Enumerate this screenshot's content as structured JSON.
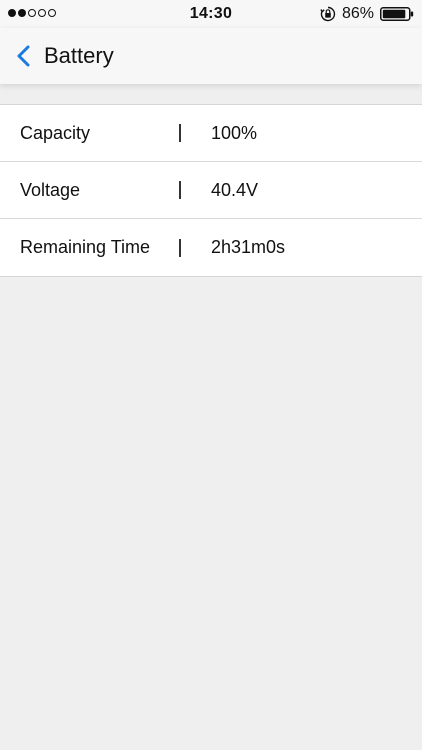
{
  "status_bar": {
    "signal_dots": [
      true,
      true,
      false,
      false,
      false
    ],
    "time": "14:30",
    "battery_percent": "86%",
    "icons": [
      "orientation-lock-icon",
      "battery-icon"
    ]
  },
  "nav": {
    "back_icon": "chevron-left-icon",
    "title": "Battery",
    "accent_color": "#1a7ae0"
  },
  "rows": [
    {
      "label": "Capacity",
      "value": "100%"
    },
    {
      "label": "Voltage",
      "value": "40.4V"
    },
    {
      "label": "Remaining Time",
      "value": "2h31m0s"
    }
  ],
  "colors": {
    "background": "#efeff0",
    "bar_background": "#f7f7f8",
    "row_background": "#ffffff"
  }
}
